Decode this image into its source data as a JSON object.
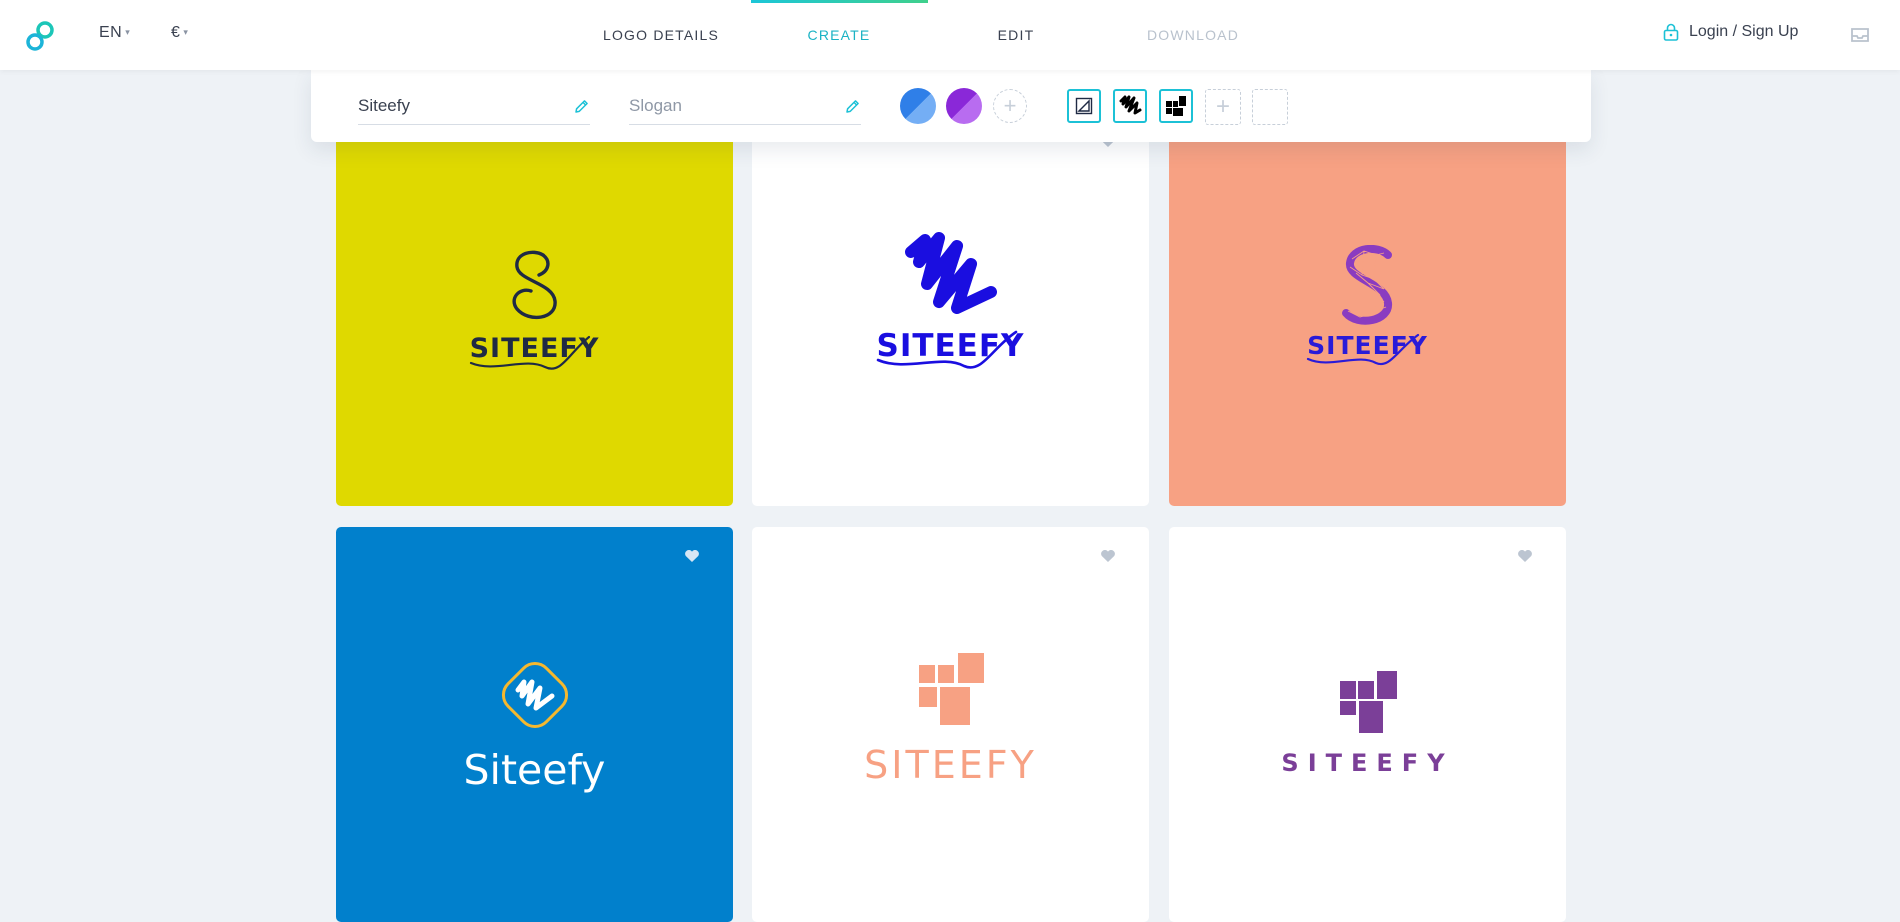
{
  "header": {
    "language": "EN",
    "currency": "€",
    "nav": [
      {
        "label": "LOGO DETAILS",
        "state": "normal"
      },
      {
        "label": "CREATE",
        "state": "active"
      },
      {
        "label": "EDIT",
        "state": "normal"
      },
      {
        "label": "DOWNLOAD",
        "state": "disabled"
      }
    ],
    "login_label": "Login / Sign Up",
    "icons": {
      "logo": "infinity-logo-icon",
      "lock": "lock-icon",
      "inbox": "inbox-icon"
    }
  },
  "editor": {
    "name_value": "Siteefy",
    "slogan_placeholder": "Slogan",
    "colors": [
      "#3b8df0",
      "#9b3be0"
    ]
  },
  "colors": {
    "accent": "#1bb3c4",
    "disabled": "#b9c2cd",
    "page_bg": "#eef2f6"
  },
  "cards": [
    {
      "bg": "#dfd900",
      "wordmark": "SITEEFY",
      "color": "#1f2a44",
      "symbol": "letter-s-swirl"
    },
    {
      "bg": "#ffffff",
      "wordmark": "SITEEFY",
      "color": "#1a0ee0",
      "symbol": "scribble"
    },
    {
      "bg": "#f7a183",
      "wordmark": "SITEEFY",
      "color": "#2a1bd8",
      "symbol": "letter-s-geometric"
    },
    {
      "bg": "#0180cc",
      "wordmark": "Siteefy",
      "color": "#ffffff",
      "symbol": "scribble-badge"
    },
    {
      "bg": "#ffffff",
      "wordmark": "SITEEFY",
      "color": "#f7a183",
      "symbol": "squares"
    },
    {
      "bg": "#ffffff",
      "wordmark": "SITEEFY",
      "color": "#7b3f98",
      "symbol": "squares"
    }
  ]
}
